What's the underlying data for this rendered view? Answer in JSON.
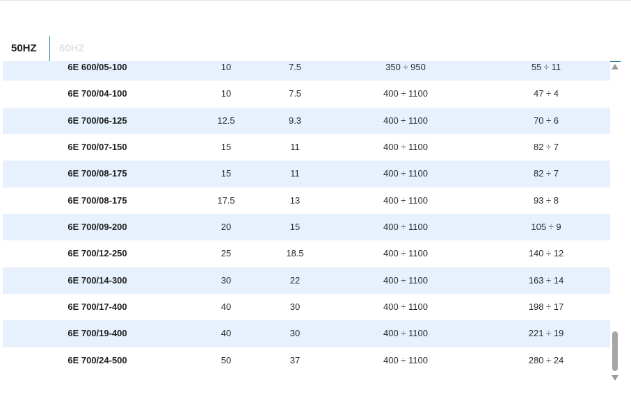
{
  "tabs": [
    {
      "label": "50HZ",
      "active": true
    },
    {
      "label": "60HZ",
      "active": false
    }
  ],
  "rows": [
    {
      "model": "6E 600/05-100",
      "c1": "10",
      "c2": "7.5",
      "c3": "350 ÷ 950",
      "c4": "55 ÷ 11"
    },
    {
      "model": "6E 700/04-100",
      "c1": "10",
      "c2": "7.5",
      "c3": "400 ÷ 1100",
      "c4": "47 ÷ 4"
    },
    {
      "model": "6E 700/06-125",
      "c1": "12.5",
      "c2": "9.3",
      "c3": "400 ÷ 1100",
      "c4": "70 ÷ 6"
    },
    {
      "model": "6E 700/07-150",
      "c1": "15",
      "c2": "11",
      "c3": "400 ÷ 1100",
      "c4": "82 ÷ 7"
    },
    {
      "model": "6E 700/08-175",
      "c1": "15",
      "c2": "11",
      "c3": "400 ÷ 1100",
      "c4": "82 ÷ 7"
    },
    {
      "model": "6E 700/08-175",
      "c1": "17.5",
      "c2": "13",
      "c3": "400 ÷ 1100",
      "c4": "93 ÷ 8"
    },
    {
      "model": "6E 700/09-200",
      "c1": "20",
      "c2": "15",
      "c3": "400 ÷ 1100",
      "c4": "105 ÷ 9"
    },
    {
      "model": "6E 700/12-250",
      "c1": "25",
      "c2": "18.5",
      "c3": "400 ÷ 1100",
      "c4": "140 ÷ 12"
    },
    {
      "model": "6E 700/14-300",
      "c1": "30",
      "c2": "22",
      "c3": "400 ÷ 1100",
      "c4": "163 ÷ 14"
    },
    {
      "model": "6E 700/17-400",
      "c1": "40",
      "c2": "30",
      "c3": "400 ÷ 1100",
      "c4": "198 ÷ 17"
    },
    {
      "model": "6E 700/19-400",
      "c1": "40",
      "c2": "30",
      "c3": "400 ÷ 1100",
      "c4": "221 ÷ 19"
    },
    {
      "model": "6E 700/24-500",
      "c1": "50",
      "c2": "37",
      "c3": "400 ÷ 1100",
      "c4": "280 ÷ 24"
    }
  ],
  "icons": {
    "scroll_up": "chevron-up-icon",
    "scroll_down": "chevron-down-icon"
  },
  "colors": {
    "accent_line": "#2a7f9e",
    "row_alt": "#e6f1fd",
    "inactive_tab": "#dfe4e8"
  }
}
